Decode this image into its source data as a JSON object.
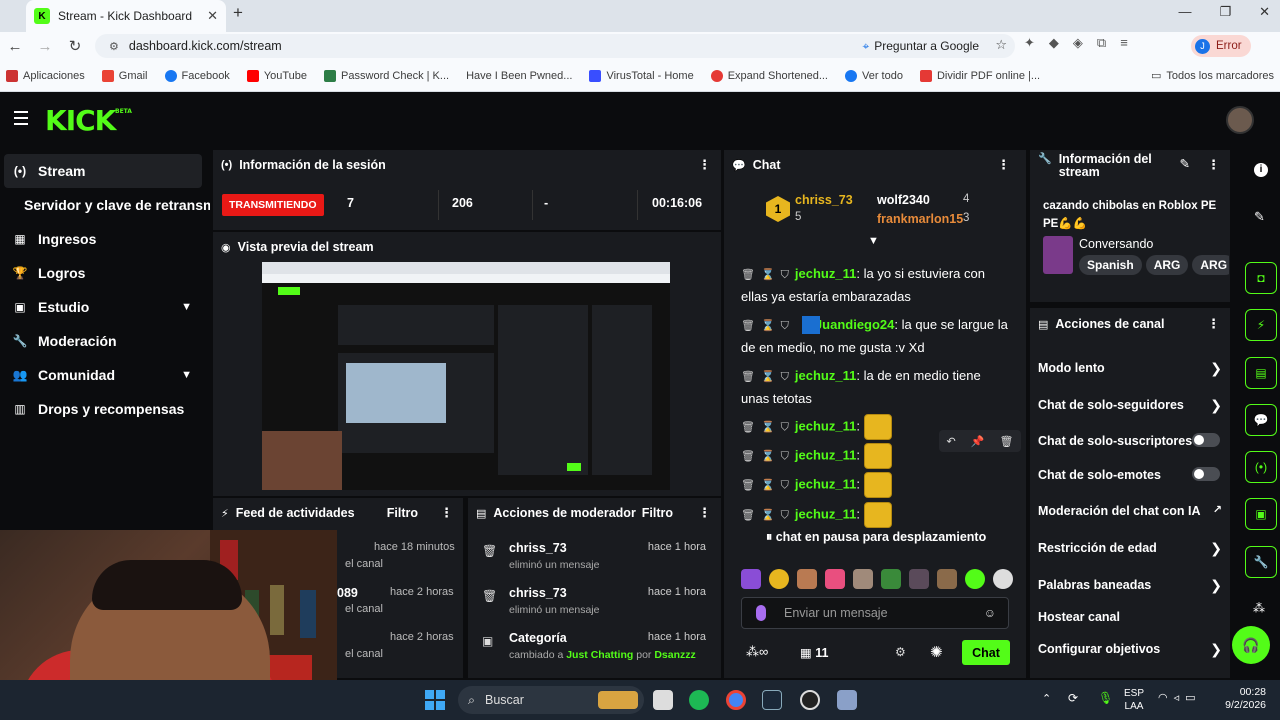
{
  "browser": {
    "tab_title": "Stream - Kick Dashboard",
    "url": "dashboard.kick.com/stream",
    "google_ask": "Preguntar a Google",
    "profile_status": "Error",
    "profile_initial": "J",
    "bookmarks": [
      "Aplicaciones",
      "Gmail",
      "Facebook",
      "YouTube",
      "Password Check | K...",
      "Have I Been Pwned...",
      "VirusTotal - Home",
      "Expand Shortened...",
      "Ver todo",
      "Dividir PDF online |..."
    ],
    "bookmarks_all": "Todos los marcadores"
  },
  "sidebar": {
    "items": [
      {
        "label": "Stream"
      },
      {
        "label": "Servidor y clave de retransmisión"
      },
      {
        "label": "Ingresos"
      },
      {
        "label": "Logros"
      },
      {
        "label": "Estudio"
      },
      {
        "label": "Moderación"
      },
      {
        "label": "Comunidad"
      },
      {
        "label": "Drops y recompensas"
      }
    ]
  },
  "session": {
    "title": "Información de la sesión",
    "status": "TRANSMITIENDO",
    "viewers": "7",
    "followers": "206",
    "subs": "-",
    "duration": "00:16:06"
  },
  "preview": {
    "title": "Vista previa del stream"
  },
  "feed": {
    "title": "Feed de actividades",
    "filter": "Filtro",
    "items": [
      {
        "time": "hace 18 minutos",
        "text": "el canal"
      },
      {
        "who": "089",
        "time": "hace 2 horas",
        "text": "el canal"
      },
      {
        "time": "hace 2 horas",
        "text": "el canal"
      }
    ]
  },
  "modactions": {
    "title": "Acciones de moderador",
    "filter": "Filtro",
    "items": [
      {
        "who": "chriss_73",
        "time": "hace 1 hora",
        "what": "eliminó un mensaje"
      },
      {
        "who": "chriss_73",
        "time": "hace 1 hora",
        "what": "eliminó un mensaje"
      },
      {
        "who": "Categoría",
        "time": "hace 1 hora",
        "what_prefix": "cambiado a",
        "category": "Just Chatting",
        "by": "por",
        "user": "Dsanzzz"
      }
    ]
  },
  "chat": {
    "title": "Chat",
    "top": [
      {
        "rank": "1",
        "name": "chriss_73",
        "count": "5"
      },
      {
        "name": "wolf2340",
        "count": "4"
      },
      {
        "name": "frankmarlon15",
        "count": "3"
      }
    ],
    "messages": [
      {
        "user": "jechuz_11",
        "text": "la yo si estuviera con ellas ya estaría embarazadas"
      },
      {
        "user": "Juandiego24",
        "text": "la que se largue la de en medio, no me gusta :v Xd"
      },
      {
        "user": "jechuz_11",
        "text": "la de en medio tiene unas tetotas"
      },
      {
        "user": "jechuz_11",
        "text": ""
      },
      {
        "user": "jechuz_11",
        "text": ""
      },
      {
        "user": "jechuz_11",
        "text": ""
      },
      {
        "user": "jechuz_11",
        "text": ""
      }
    ],
    "paused": "chat en pausa para desplazamiento",
    "input_placeholder": "Enviar un mensaje",
    "points": "11",
    "send_label": "Chat"
  },
  "streaminfo": {
    "title": "Información del stream",
    "stream_title": "cazando chibolas en Roblox PE PE💪💪",
    "category": "Conversando",
    "tags": [
      "Spanish",
      "ARG",
      "ARG"
    ]
  },
  "channelactions": {
    "title": "Acciones de canal",
    "items": [
      {
        "label": "Modo lento",
        "kind": "arrow"
      },
      {
        "label": "Chat de solo-seguidores",
        "kind": "arrow"
      },
      {
        "label": "Chat de solo-suscriptores",
        "kind": "toggle"
      },
      {
        "label": "Chat de solo-emotes",
        "kind": "toggle"
      },
      {
        "label": "Moderación del chat con IA",
        "kind": "external"
      },
      {
        "label": "Restricción de edad",
        "kind": "arrow"
      },
      {
        "label": "Palabras baneadas",
        "kind": "arrow"
      },
      {
        "label": "Hostear canal",
        "kind": "none"
      },
      {
        "label": "Configurar objetivos",
        "kind": "arrow"
      }
    ]
  },
  "taskbar": {
    "search": "Buscar",
    "lang1": "ESP",
    "lang2": "LAA",
    "time": "00:28",
    "date": "9/2/2026"
  },
  "colors": {
    "kick_green": "#53fc18",
    "live_red": "#e91916",
    "panel": "#191b1f"
  }
}
